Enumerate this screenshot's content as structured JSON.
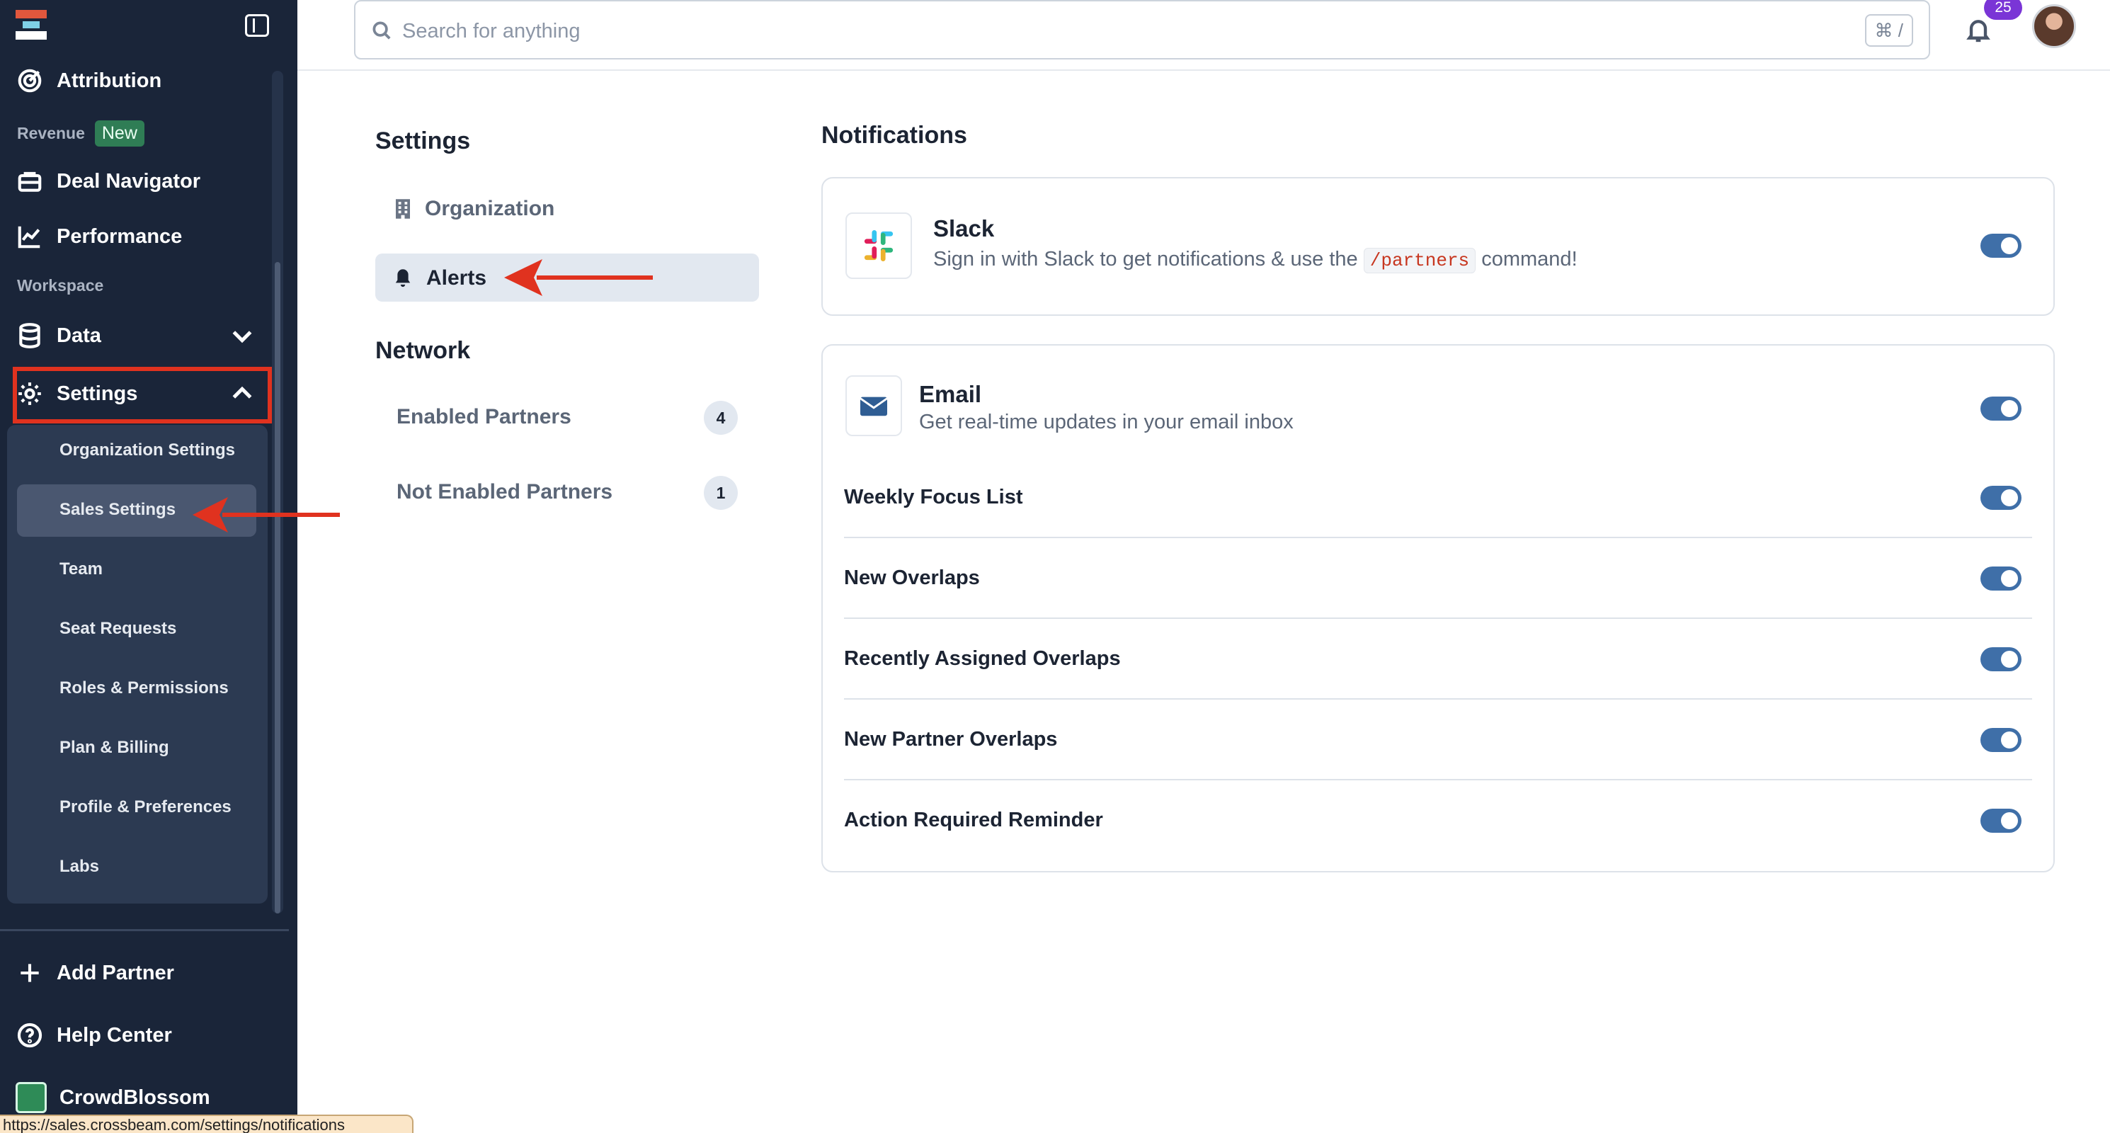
{
  "sidebar": {
    "attribution": "Attribution",
    "revenue_label": "Revenue",
    "new_badge": "New",
    "deal_navigator": "Deal Navigator",
    "performance": "Performance",
    "workspace_label": "Workspace",
    "data": "Data",
    "settings": "Settings",
    "sub_items": [
      "Organization Settings",
      "Sales Settings",
      "Team",
      "Seat Requests",
      "Roles & Permissions",
      "Plan & Billing",
      "Profile & Preferences",
      "Labs"
    ],
    "add_partner": "Add Partner",
    "help_center": "Help Center",
    "org_name": "CrowdBlossom"
  },
  "status_url": "https://sales.crossbeam.com/settings/notifications",
  "topbar": {
    "search_placeholder": "Search for anything",
    "shortcut": "⌘ /",
    "notification_count": "25"
  },
  "settings_nav": {
    "title": "Settings",
    "organization": "Organization",
    "alerts": "Alerts",
    "network_title": "Network",
    "enabled_partners": "Enabled Partners",
    "enabled_count": "4",
    "not_enabled_partners": "Not Enabled Partners",
    "not_enabled_count": "1"
  },
  "notifications": {
    "title": "Notifications",
    "slack": {
      "title": "Slack",
      "desc_before": "Sign in with Slack to get notifications & use the",
      "command": "/partners",
      "desc_after": "command!"
    },
    "email": {
      "title": "Email",
      "desc": "Get real-time updates in your email inbox"
    },
    "rows": [
      "Weekly Focus List",
      "New Overlaps",
      "Recently Assigned Overlaps",
      "New Partner Overlaps",
      "Action Required Reminder"
    ]
  },
  "colors": {
    "sidebar_bg": "#1a2539",
    "toggle_on": "#3f6fa8",
    "annotation_red": "#e0321f",
    "new_badge": "#2f7d55"
  }
}
